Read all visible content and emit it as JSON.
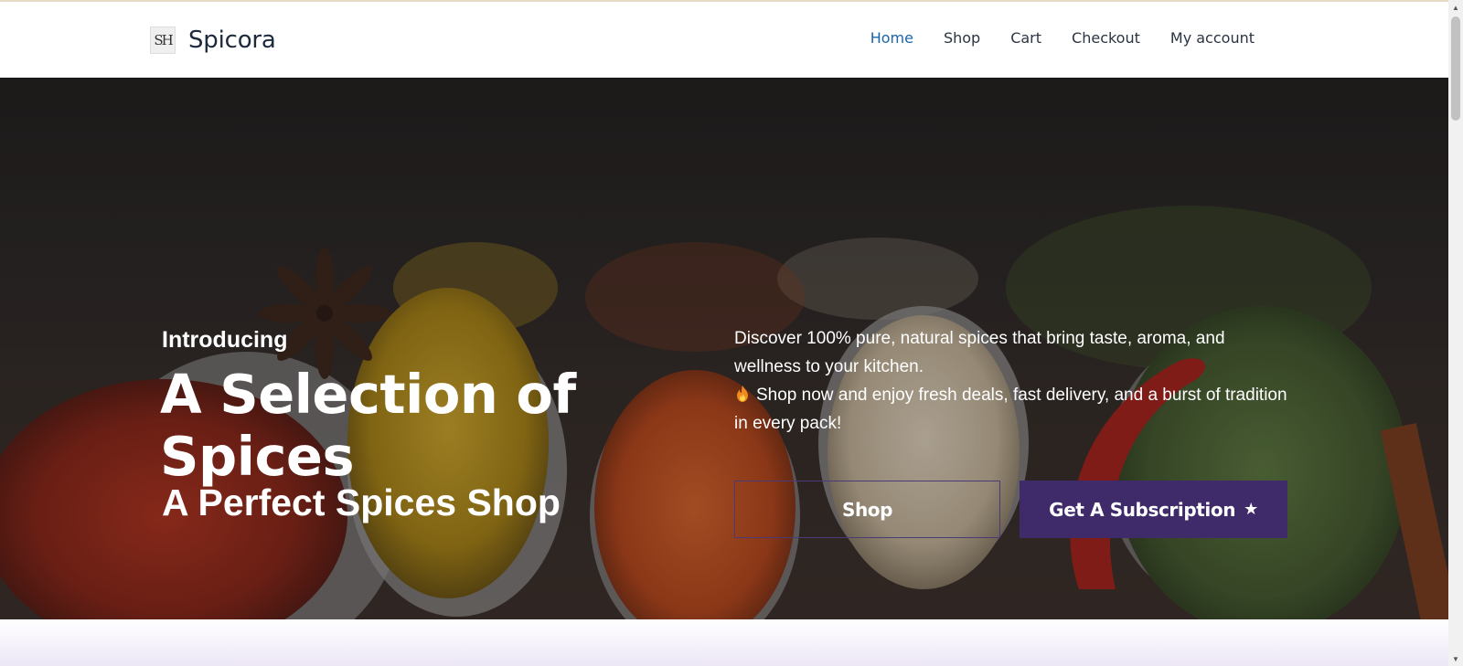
{
  "header": {
    "logo_text": "SH",
    "site_title": "Spicora",
    "nav": [
      {
        "label": "Home",
        "active": true
      },
      {
        "label": "Shop",
        "active": false
      },
      {
        "label": "Cart",
        "active": false
      },
      {
        "label": "Checkout",
        "active": false
      },
      {
        "label": "My account",
        "active": false
      }
    ]
  },
  "hero": {
    "intro": "Introducing",
    "headline": "A Selection of Spices",
    "subline": "A Perfect Spices Shop",
    "description_1": "Discover 100% pure, natural spices that bring taste, aroma, and wellness to your kitchen.",
    "description_2": "Shop now and enjoy fresh deals, fast delivery, and a burst of tradition in every pack!",
    "shop_button": "Shop",
    "subscription_button": "Get A Subscription",
    "subscription_icon": "star-icon"
  },
  "colors": {
    "accent": "#3f2a6a",
    "nav_active": "#1d64a8",
    "title": "#1d2a3c"
  }
}
